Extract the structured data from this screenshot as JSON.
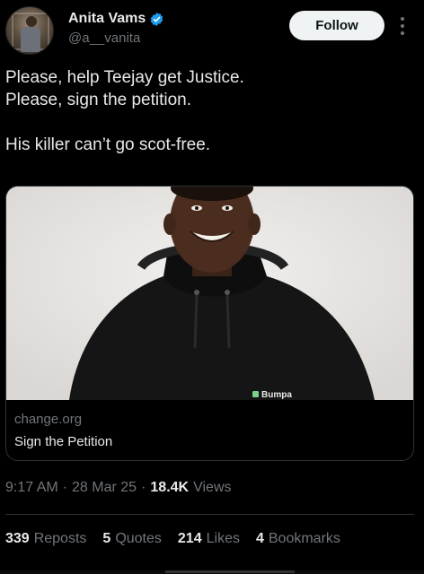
{
  "author": {
    "name": "Anita Vams",
    "handle": "@a__vanita",
    "verified_icon": "verified-badge-icon",
    "verified_color": "#1d9bf0"
  },
  "follow_button": {
    "label": "Follow"
  },
  "tweet": {
    "lines": [
      "Please, help Teejay get Justice.",
      "Please, sign the petition.",
      "",
      "His killer can’t go scot-free."
    ]
  },
  "link_card": {
    "domain": "change.org",
    "title": "Sign the Petition",
    "image_brand_text": "Bumpa"
  },
  "meta": {
    "time": "9:17 AM",
    "separator": "·",
    "date": "28 Mar 25",
    "views_count": "18.4K",
    "views_label": "Views"
  },
  "stats": [
    {
      "count": "339",
      "label": "Reposts"
    },
    {
      "count": "5",
      "label": "Quotes"
    },
    {
      "count": "214",
      "label": "Likes"
    },
    {
      "count": "4",
      "label": "Bookmarks"
    }
  ],
  "colors": {
    "background": "#000000",
    "text_primary": "#e7e9ea",
    "text_secondary": "#71767b",
    "border": "#2f3336",
    "follow_bg": "#eff3f4"
  }
}
